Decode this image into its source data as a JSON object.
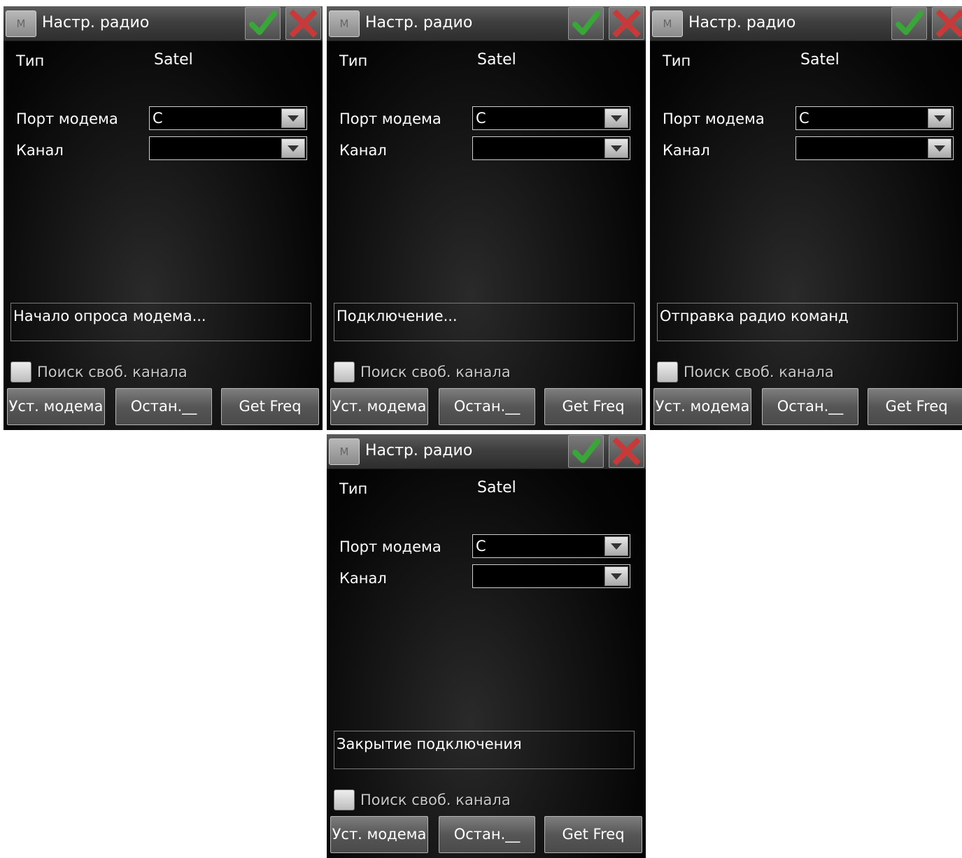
{
  "dialog": {
    "menu_icon": "M",
    "title": "Настр. радио",
    "ok_icon": "checkmark-icon",
    "close_icon": "close-x-icon",
    "type_label": "Тип",
    "type_value": "Satel",
    "port_label": "Порт модема",
    "port_value": "C",
    "channel_label": "Канал",
    "channel_value": "",
    "search_free_channel_label": "Поиск своб. канала",
    "search_free_channel_checked": false,
    "buttons": {
      "setup_modem": "Уст. модема",
      "stop": "Остан.__",
      "get_freq": "Get Freq"
    },
    "colors": {
      "ok": "#3aa63a",
      "close": "#c83a3a"
    }
  },
  "panels": [
    {
      "status_text": "Начало опроса модема..."
    },
    {
      "status_text": "Подключение..."
    },
    {
      "status_text": "Отправка радио команд"
    },
    {
      "status_text": "Закрытие подключения"
    }
  ]
}
